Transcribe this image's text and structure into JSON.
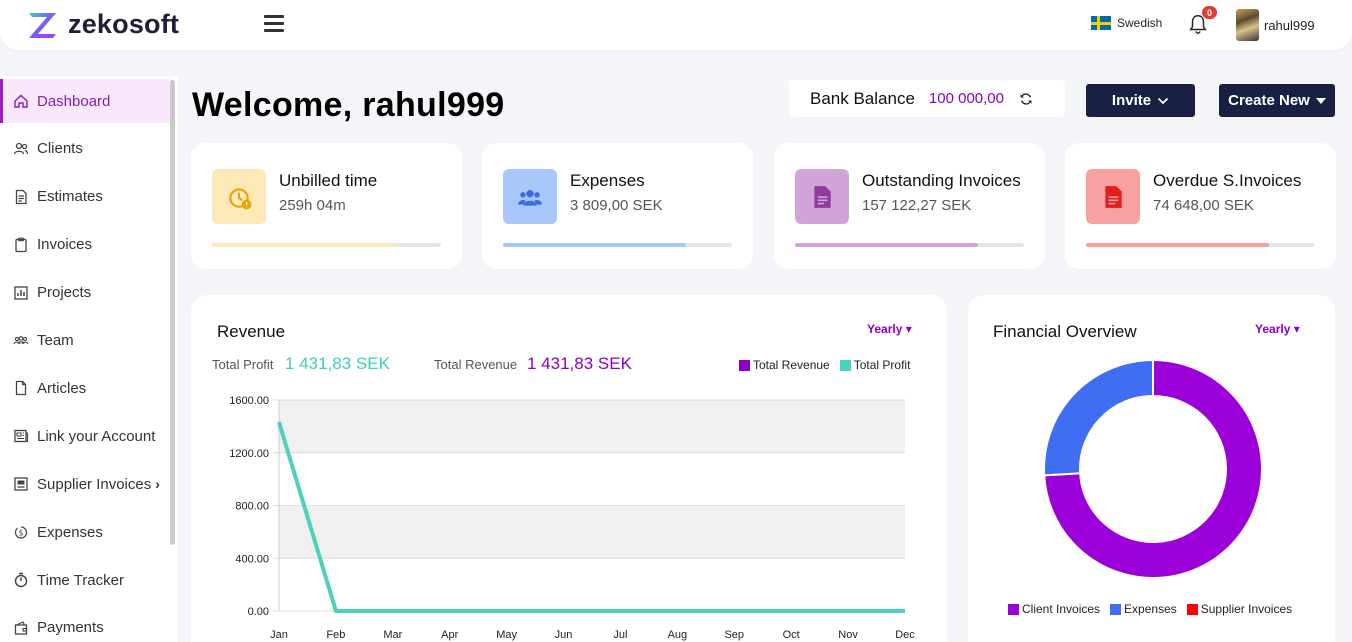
{
  "header": {
    "brand": "zekosoft",
    "language": "Swedish",
    "notifications_count": "0",
    "username": "rahul999"
  },
  "sidebar": {
    "items": [
      {
        "label": "Dashboard",
        "icon": "home-icon",
        "active": true
      },
      {
        "label": "Clients",
        "icon": "users-icon"
      },
      {
        "label": "Estimates",
        "icon": "document-icon"
      },
      {
        "label": "Invoices",
        "icon": "clipboard-icon"
      },
      {
        "label": "Projects",
        "icon": "bar-chart-icon"
      },
      {
        "label": "Team",
        "icon": "team-icon"
      },
      {
        "label": "Articles",
        "icon": "file-icon"
      },
      {
        "label": "Link your Account",
        "icon": "newspaper-icon"
      },
      {
        "label": "Supplier Invoices",
        "icon": "receipt-icon",
        "has_submenu": true
      },
      {
        "label": "Expenses",
        "icon": "money-icon"
      },
      {
        "label": "Time Tracker",
        "icon": "stopwatch-icon"
      },
      {
        "label": "Payments",
        "icon": "wallet-icon"
      }
    ]
  },
  "main": {
    "welcome": "Welcome, rahul999",
    "bank_balance": {
      "label": "Bank Balance",
      "value": "100 000,00"
    },
    "invite_label": "Invite",
    "create_new_label": "Create New"
  },
  "cards": [
    {
      "title": "Unbilled time",
      "value": "259h 04m",
      "icon": "clock-alert-icon",
      "color": "#fde9b8",
      "icon_color": "#e6a400",
      "bar_color": "#fde9b8",
      "progress": 0.8
    },
    {
      "title": "Expenses",
      "value": "3 809,00 SEK",
      "icon": "people-group-icon",
      "color": "#a8c8fb",
      "icon_color": "#3a6fd8",
      "bar_color": "#a8c8fb",
      "progress": 0.8
    },
    {
      "title": "Outstanding Invoices",
      "value": "157 122,27 SEK",
      "icon": "invoice-doc-icon",
      "color": "#d2a3d9",
      "icon_color": "#8e3b9a",
      "bar_color": "#d2a3d9",
      "progress": 0.8
    },
    {
      "title": "Overdue S.Invoices",
      "value": "74 648,00 SEK",
      "icon": "pdf-doc-icon",
      "color": "#f7a0a0",
      "icon_color": "#e51c1c",
      "bar_color": "#f7a0a0",
      "progress": 0.8
    }
  ],
  "revenue": {
    "title": "Revenue",
    "period": "Yearly",
    "total_profit_label": "Total Profit",
    "total_profit_value": "1 431,83 SEK",
    "total_revenue_label": "Total Revenue",
    "total_revenue_value": "1 431,83 SEK",
    "profit_color": "#3dcfb5",
    "revenue_color": "#8b00c9"
  },
  "financial": {
    "title": "Financial Overview",
    "period": "Yearly"
  },
  "chart_data": [
    {
      "type": "line",
      "categories": [
        "Jan",
        "Feb",
        "Mar",
        "Apr",
        "May",
        "Jun",
        "Jul",
        "Aug",
        "Sep",
        "Oct",
        "Nov",
        "Dec"
      ],
      "series": [
        {
          "name": "Total Revenue",
          "color": "#8b00c9",
          "values": [
            1431.83,
            0,
            0,
            0,
            0,
            0,
            0,
            0,
            0,
            0,
            0,
            0
          ]
        },
        {
          "name": "Total Profit",
          "color": "#4dd0bd",
          "values": [
            1431.83,
            0,
            0,
            0,
            0,
            0,
            0,
            0,
            0,
            0,
            0,
            0
          ]
        }
      ],
      "yticks": [
        "1600.00",
        "1200.00",
        "800.00",
        "400.00",
        "0.00"
      ],
      "ylim": [
        0,
        1600
      ],
      "legend_position": "top-right",
      "grid": true
    },
    {
      "type": "pie",
      "donut": true,
      "labels": [
        "Client Invoices",
        "Expenses",
        "Supplier Invoices"
      ],
      "colors": [
        "#9b00d9",
        "#3f6ef2",
        "#ff0000"
      ],
      "values": [
        157122.27,
        55000,
        0
      ],
      "legend_position": "bottom"
    }
  ]
}
